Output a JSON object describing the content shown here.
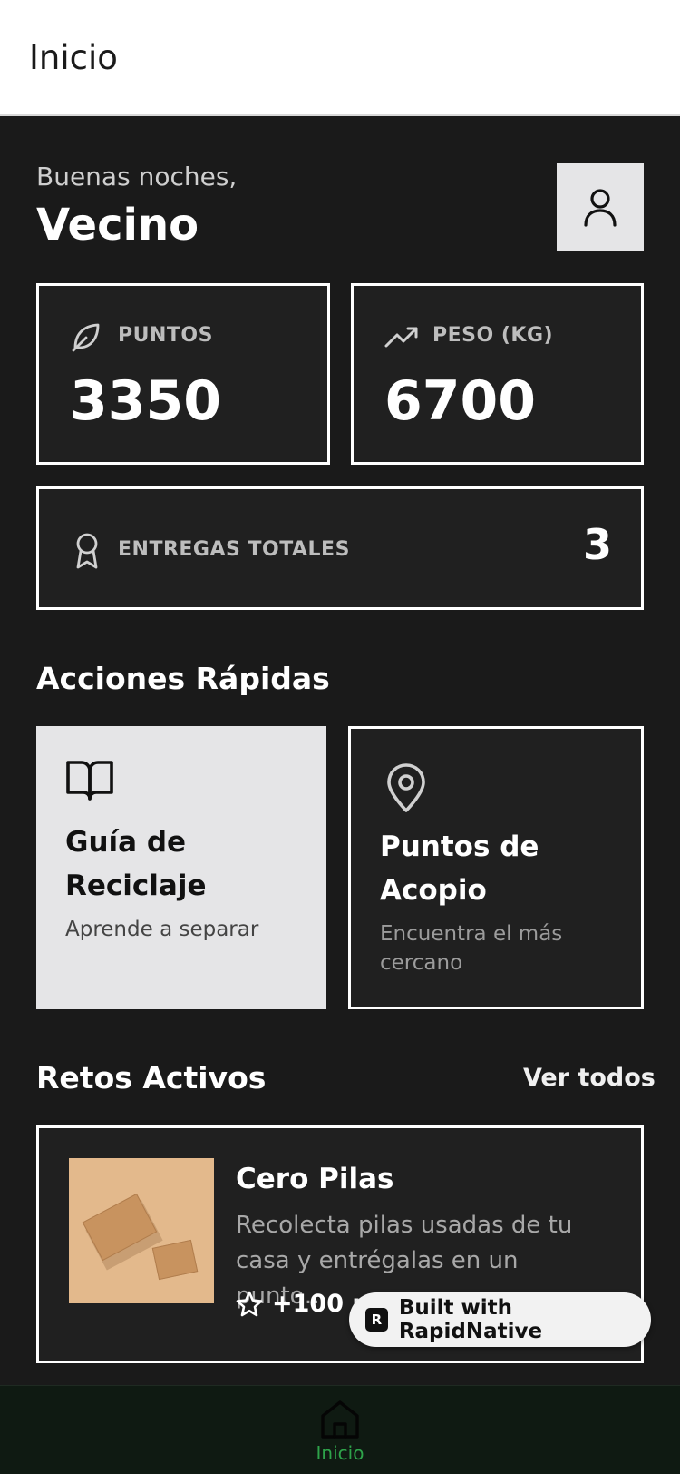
{
  "header": {
    "title": "Inicio"
  },
  "greeting": {
    "salutation": "Buenas noches,",
    "name": "Vecino"
  },
  "stats": {
    "points": {
      "label": "PUNTOS",
      "value": "3350"
    },
    "weight": {
      "label": "PESO (KG)",
      "value": "6700"
    },
    "deliveries": {
      "label": "ENTREGAS TOTALES",
      "value": "3"
    }
  },
  "quick_actions": {
    "title": "Acciones Rápidas",
    "items": [
      {
        "title_line1": "Guía de",
        "title_line2": "Reciclaje",
        "subtitle": "Aprende a separar",
        "icon": "book-open-icon"
      },
      {
        "title_line1": "Puntos de",
        "title_line2": "Acopio",
        "subtitle_line1": "Encuentra el más",
        "subtitle_line2": "cercano",
        "icon": "map-pin-icon"
      }
    ]
  },
  "challenges": {
    "title": "Retos Activos",
    "see_all": "Ver todos",
    "items": [
      {
        "title": "Cero Pilas",
        "description_line1": "Recolecta pilas usadas de tu",
        "description_line2": "casa y entrégalas en un punto…",
        "points": "+100 p"
      }
    ]
  },
  "badge": {
    "text": "Built with RapidNative"
  },
  "tabbar": {
    "items": [
      {
        "label": "Inicio",
        "icon": "home-icon",
        "active": true
      }
    ]
  },
  "colors": {
    "background": "#1a1a1a",
    "card": "#202020",
    "accent_green": "#2ea34a",
    "light_card": "#e5e5e7"
  }
}
